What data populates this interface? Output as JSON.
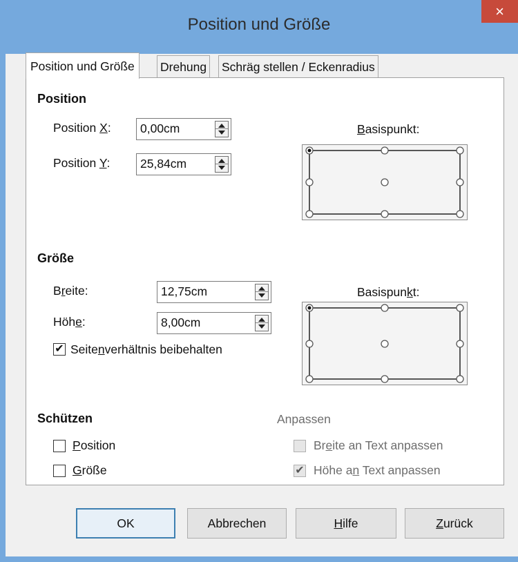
{
  "window": {
    "title": "Position und Größe",
    "close_glyph": "×"
  },
  "tabs": [
    {
      "label": "Position und Größe",
      "active": true
    },
    {
      "label": "Drehung",
      "active": false
    },
    {
      "label": "Schräg stellen / Eckenradius",
      "active": false
    }
  ],
  "position": {
    "heading": "Position",
    "x_label_pre": "Position ",
    "x_label_key": "X",
    "x_label_post": ":",
    "x_value": "0,00cm",
    "y_label_pre": "Position ",
    "y_label_key": "Y",
    "y_label_post": ":",
    "y_value": "25,84cm",
    "basis_label_key": "B",
    "basis_label_rest": "asispunkt:",
    "basis_selected": "top-left"
  },
  "size": {
    "heading": "Größe",
    "width_label_pre": "B",
    "width_label_key": "r",
    "width_label_post": "eite:",
    "width_value": "12,75cm",
    "height_label_pre": "Höh",
    "height_label_key": "e",
    "height_label_post": ":",
    "height_value": "8,00cm",
    "keep_ratio_pre": "Seite",
    "keep_ratio_key": "n",
    "keep_ratio_post": "verhältnis beibehalten",
    "keep_ratio_checked": true,
    "basis_label_pre": "Basispun",
    "basis_label_key": "k",
    "basis_label_post": "t:",
    "basis_selected": "top-left"
  },
  "protect": {
    "heading": "Schützen",
    "position_key": "P",
    "position_rest": "osition",
    "position_checked": false,
    "size_key": "G",
    "size_rest": "röße",
    "size_checked": false
  },
  "adapt": {
    "heading": "Anpassen",
    "width_pre": "Br",
    "width_key": "e",
    "width_post": "ite an Text anpassen",
    "width_checked": false,
    "height_pre": "Höhe a",
    "height_key": "n",
    "height_post": " Text anpassen",
    "height_checked": true
  },
  "buttons": {
    "ok": "OK",
    "cancel": "Abbrechen",
    "help_key": "H",
    "help_rest": "ilfe",
    "reset_key": "Z",
    "reset_rest": "urück"
  },
  "colors": {
    "titlebar": "#75a9dd",
    "close": "#c74a3b",
    "accent": "#3c7fb1"
  }
}
